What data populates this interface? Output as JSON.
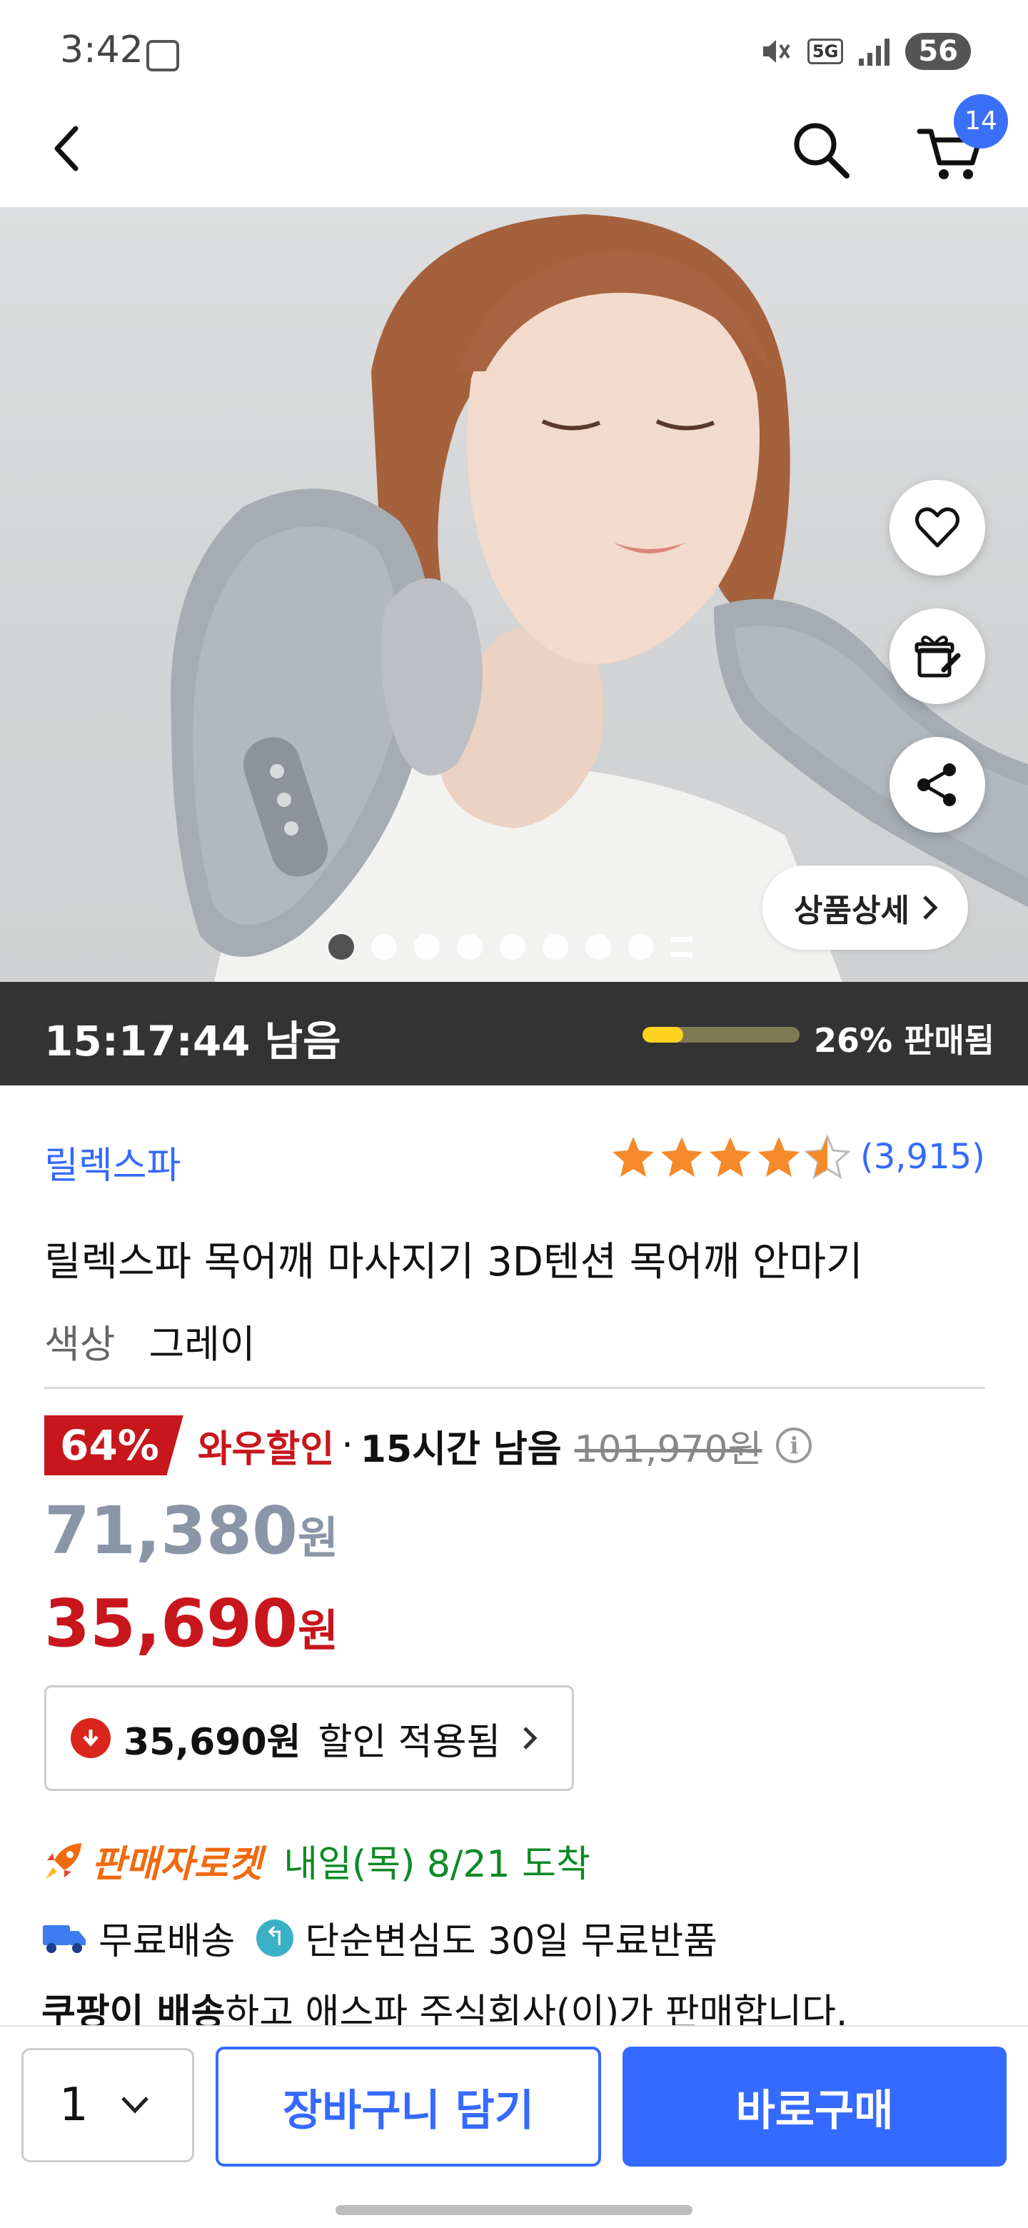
{
  "status_bar": {
    "time": "3:42",
    "network": "5G",
    "battery": "56"
  },
  "nav": {
    "cart_count": "14"
  },
  "hero": {
    "detail_button": "상품상세",
    "slide_count": 8,
    "active_slide": 1
  },
  "deal": {
    "timer_text": "15:17:44 남음",
    "sold_percent": 26,
    "sold_text": "26% 판매됨"
  },
  "product": {
    "brand": "릴렉스파",
    "rating": 4.5,
    "review_count": "(3,915)",
    "title": "릴렉스파 목어깨 마사지기 3D텐션 목어깨 안마기",
    "color_label": "색상",
    "color_value": "그레이"
  },
  "pricing": {
    "discount_pct": "64%",
    "wow_label": "와우할인",
    "separator": "·",
    "time_left": "15시간 남음",
    "original_price": "101,970원",
    "price_before": "71,380",
    "price_before_unit": "원",
    "sale_price": "35,690",
    "sale_price_unit": "원",
    "coupon_amount": "35,690원",
    "coupon_text": "할인 적용됨"
  },
  "delivery": {
    "rocket_label": "판매자로켓",
    "arrival": "내일(목) 8/21 도착",
    "free_shipping": "무료배송",
    "returns": "단순변심도 30일 무료반품",
    "seller_bold": "쿠팡이 배송",
    "seller_rest": "하고 애스파 주식회사(이)가 판매합니다."
  },
  "bottom_bar": {
    "quantity": "1",
    "add_to_cart": "장바구니 담기",
    "buy_now": "바로구매"
  },
  "colors": {
    "accent": "#346aff",
    "sale_red": "#c8161d",
    "timer_bg": "#333333",
    "progress": "#ffd21f",
    "rocket": "#f06a10",
    "arrival_green": "#0d8a25"
  }
}
